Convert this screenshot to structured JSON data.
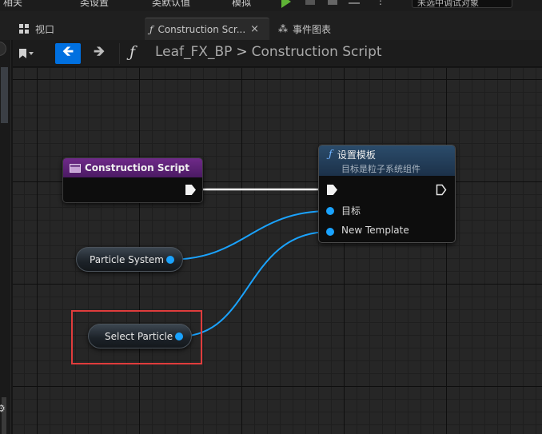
{
  "toolbar": {
    "item1": "相关",
    "item2": "类设置",
    "item3": "类默认值",
    "item4": "模拟",
    "dropdown": "未选中调试对象"
  },
  "tabs": [
    {
      "label": "视口",
      "icon": "viewport-grid-icon"
    },
    {
      "label": "Construction Scr...",
      "icon": "function-icon",
      "close": "×"
    },
    {
      "label": "事件图表",
      "icon": "event-graph-icon"
    }
  ],
  "breadcrumb": {
    "blueprint": "Leaf_FX_BP",
    "separator": ">",
    "function": "Construction Script"
  },
  "nodes": {
    "construction_script": {
      "title": "Construction Script"
    },
    "set_template": {
      "title": "设置模板",
      "subtitle": "目标是粒子系统组件",
      "pin_target": "目标",
      "pin_template": "New Template"
    },
    "particle_system": {
      "label": "Particle System"
    },
    "select_particle": {
      "label": "Select Particle"
    }
  },
  "colors": {
    "accent_blue": "#0070e0",
    "data_wire": "#1aa3ff",
    "function_header": "#2b4c6b",
    "event_header": "#6f2a89",
    "highlight_box": "#e03c3c"
  }
}
